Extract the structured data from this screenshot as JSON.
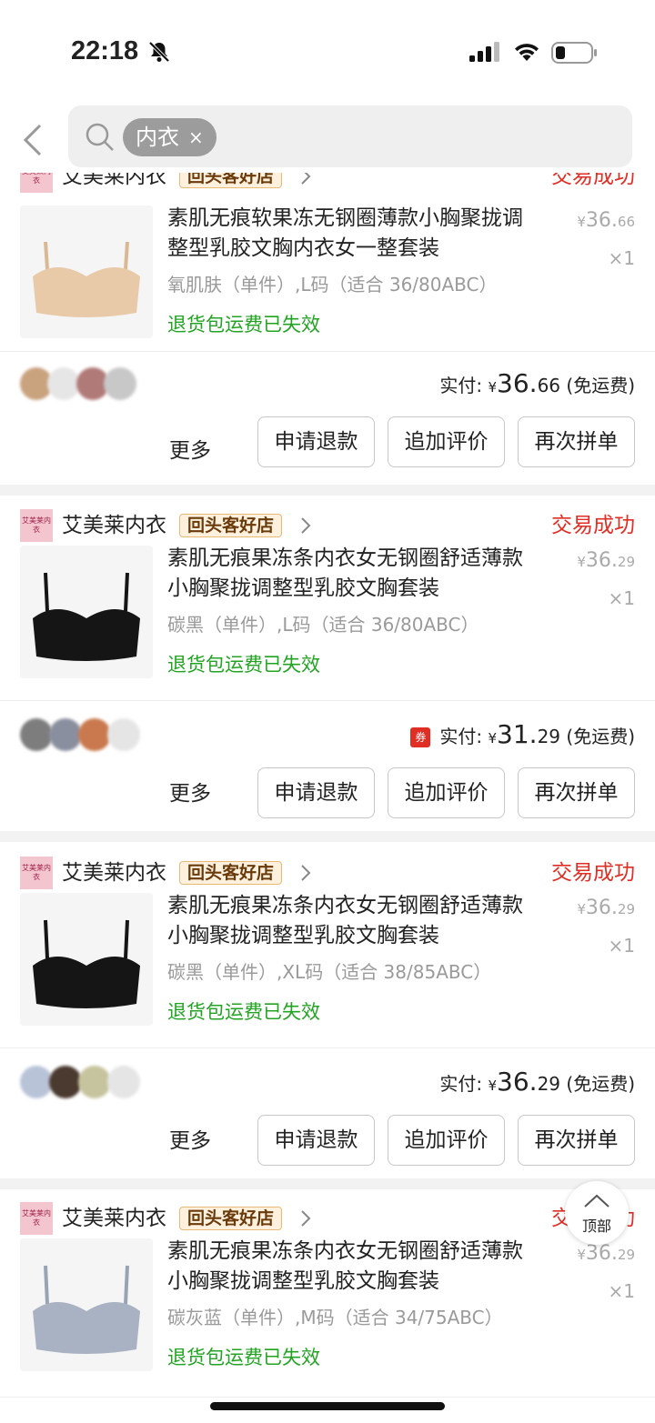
{
  "status_bar": {
    "time": "22:18"
  },
  "search": {
    "tag": "内衣",
    "tag_close": "×"
  },
  "shop": {
    "logo_text": "艾美莱内衣",
    "name": "艾美莱内衣",
    "badge": "回头客好店"
  },
  "actions": {
    "more": "更多",
    "refund": "申请退款",
    "review": "追加评价",
    "reorder": "再次拼单"
  },
  "orders": [
    {
      "status": "交易成功",
      "title": "素肌无痕软果冻无钢圈薄款小胸聚拢调整型乳胶文胸内衣女一整套装",
      "spec": "氧肌肤（单件）,L码（适合 36/80ABC）",
      "return_note": "退货包运费已失效",
      "price_symbol": "¥",
      "price_int": "36.",
      "price_dec": "66",
      "qty": "×1",
      "paid_label": "实付:",
      "paid_symbol": "¥",
      "paid_int": "36.",
      "paid_dec": "66",
      "shipping": "(免运费)",
      "product_color": "#e8c9a8"
    },
    {
      "status": "交易成功",
      "title": "素肌无痕果冻条内衣女无钢圈舒适薄款小胸聚拢调整型乳胶文胸套装",
      "spec": "碳黑（单件）,L码（适合 36/80ABC）",
      "return_note": "退货包运费已失效",
      "price_symbol": "¥",
      "price_int": "36.",
      "price_dec": "29",
      "qty": "×1",
      "coupon": "券",
      "paid_label": "实付:",
      "paid_symbol": "¥",
      "paid_int": "31.",
      "paid_dec": "29",
      "shipping": "(免运费)",
      "product_color": "#151515"
    },
    {
      "status": "交易成功",
      "title": "素肌无痕果冻条内衣女无钢圈舒适薄款小胸聚拢调整型乳胶文胸套装",
      "spec": "碳黑（单件）,XL码（适合 38/85ABC）",
      "return_note": "退货包运费已失效",
      "price_symbol": "¥",
      "price_int": "36.",
      "price_dec": "29",
      "qty": "×1",
      "paid_label": "实付:",
      "paid_symbol": "¥",
      "paid_int": "36.",
      "paid_dec": "29",
      "shipping": "(免运费)",
      "product_color": "#151515"
    },
    {
      "status": "交易成功",
      "title": "素肌无痕果冻条内衣女无钢圈舒适薄款小胸聚拢调整型乳胶文胸套装",
      "spec": "碳灰蓝（单件）,M码（适合 34/75ABC）",
      "return_note": "退货包运费已失效",
      "price_symbol": "¥",
      "price_int": "36.",
      "price_dec": "29",
      "qty": "×1",
      "product_color": "#a9b2c2"
    }
  ],
  "back_to_top": "顶部"
}
